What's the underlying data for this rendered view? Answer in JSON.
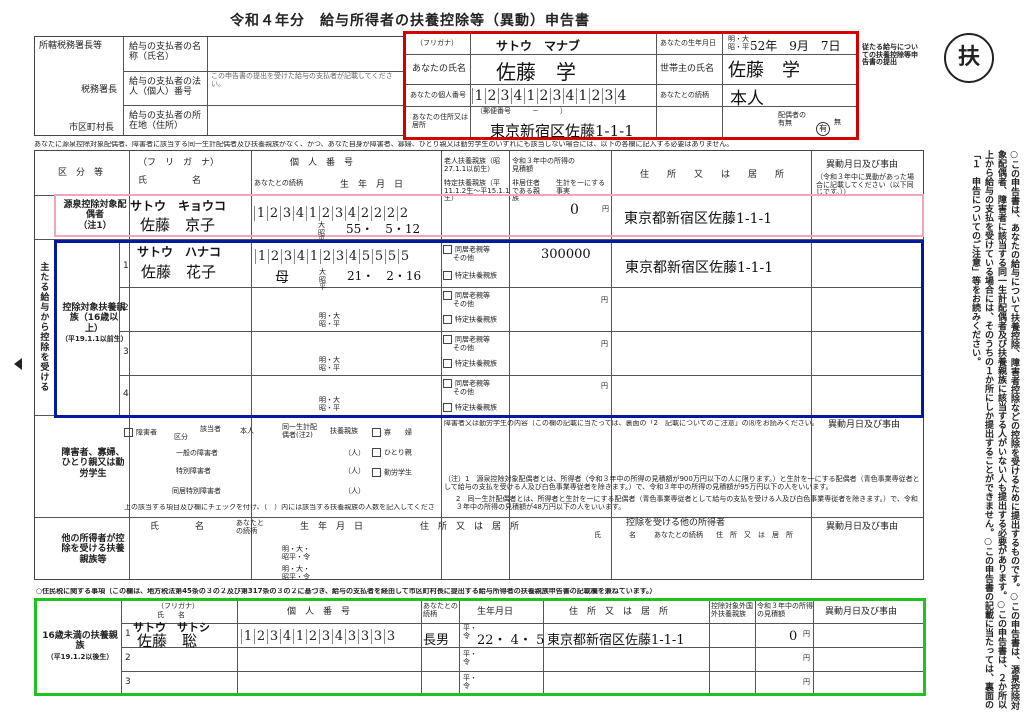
{
  "title": "令和４年分　給与所得者の扶養控除等（異動）申告書",
  "badge": "扶",
  "header": {
    "left_labels": {
      "tax_office": "所轄税務署長等",
      "tax_office_suffix": "税務署長",
      "city": "市区町村長"
    },
    "payer_name": "給与の支払者の名称（氏名）",
    "payer_number": "給与の支払者の法人（個人）番号",
    "payer_number_note": "この申告書の提出を受けた給与の支払者が記載してください。",
    "payer_address": "給与の支払者の所在地（住所）",
    "furigana_label": "（フリガナ）",
    "furigana": "サトウ　マナブ",
    "name_label": "あなたの氏名",
    "name": "佐藤　学",
    "mynumber_label": "あなたの個人番号",
    "mynumber": [
      "1",
      "2",
      "3",
      "4",
      "1",
      "2",
      "3",
      "4",
      "1",
      "2",
      "3",
      "4"
    ],
    "address_label": "あなたの住所又は居所",
    "postal": "（郵便番号　　　－　　　）",
    "address": "東京新宿区佐藤1-1-1",
    "birth_label": "あなたの生年月日",
    "era": "明・大昭・平",
    "birth": "52年　9月　7日",
    "householder_label": "世帯主の氏名",
    "householder": "佐藤　学",
    "relation_label": "あなたとの続柄",
    "relation": "本人",
    "spouse_label": "配偶者の有無",
    "spouse_yes": "有",
    "spouse_no": "無",
    "right_note": "従たる給与についての扶養控除等申告書の提出"
  },
  "notice": "あなたに源泉控除対象配偶者、障害者に該当する同一生計配偶者及び扶養親族がなく、かつ、あなた自身が障害者、寡婦、ひとり親又は勤労学生のいずれにも該当しない場合には、以下の各欄に記入する必要はありません。",
  "columns": {
    "category": "区　分　等",
    "furigana": "（フ　リ　ガ　ナ）",
    "name": "氏　　　　　名",
    "mynumber": "個　人　番　号",
    "relation": "あなたとの続柄",
    "birth": "生　年　月　日",
    "elderly": "老人扶養親族（昭27.1.1以前生）",
    "specific": "特定扶養親族（平11.1.2生～平15.1.1生）",
    "income": "令和３年中の所得の見積額",
    "nonresident": "非居住者である親族",
    "same_budget": "生計を一にする事実",
    "address": "住　　所　　又　　は　　居　　所",
    "change": "異動月日及び事由",
    "change_note": "（令和３年中に異動があった場合に記載してください（以下同じです。））"
  },
  "sectionA": {
    "label": "源泉控除対象配偶者",
    "note": "（注1）",
    "furigana": "サトウ　キョウコ",
    "name": "佐藤　京子",
    "mynumber": [
      "1",
      "2",
      "3",
      "4",
      "1",
      "2",
      "3",
      "4",
      "2",
      "2",
      "2",
      "2"
    ],
    "era": "大昭平",
    "birth": "55・　5・12",
    "income": "0",
    "yen": "円",
    "address": "東京都新宿区佐藤1-1-1"
  },
  "sectionB": {
    "side": "主たる給与から控除を受ける",
    "label": "控除対象扶養親族（16歳以上）",
    "sub": "（平19.1.1以前生）",
    "row1": {
      "num": "1",
      "furigana": "サトウ　ハナコ",
      "name": "佐藤　花子",
      "mynumber": [
        "1",
        "2",
        "3",
        "4",
        "1",
        "2",
        "3",
        "4",
        "5",
        "5",
        "5",
        "5"
      ],
      "relation": "母",
      "era": "大昭平",
      "birth": "21・　2・16",
      "opt1": "同居老親等",
      "opt2": "その他",
      "opt3": "特定扶養親族",
      "income": "300000",
      "address": "東京都新宿区佐藤1-1-1"
    },
    "nums": [
      "2",
      "3",
      "4"
    ],
    "era_empty": "明・大昭・平",
    "opt_a": "同居老親等",
    "opt_b": "その他",
    "opt_c": "特定扶養親族",
    "yen": "円"
  },
  "sectionC": {
    "label": "障害者、寡婦、ひとり親又は勤労学生",
    "disabled": "障害者",
    "kubun": "区分",
    "applicable": "該当者",
    "self": "本人",
    "same_spouse": "同一生計配偶者(注2)",
    "dependents": "扶養親族",
    "rows": [
      "一般の障害者",
      "特別障害者",
      "同居特別障害者"
    ],
    "people": "（人）",
    "widow": "寡　　婦",
    "single": "ひとり親",
    "student": "勤労学生",
    "footer": "上の該当する項目及び欄にチェックを付け、（　）内には該当する扶養親族の人数を記入してください。",
    "content_note": "障害者又は勤労学生の内容（この欄の記載に当たっては、裏面の「2　記載についてのご注意」の⑻をお読みください。）",
    "change": "異動月日及び事由",
    "note1": "（注）1　源泉控除対象配偶者とは、所得者（令和３年中の所得の見積額が900万円以下の人に限ります。）と生計を一にする配偶者（青色事業専従者として給与の支払を受ける人及び白色事業専従者を除きます。）で、令和３年中の所得の見積額が95万円以下の人をいいます。",
    "note2": "2　同一生計配偶者とは、所得者と生計を一にする配偶者（青色事業専従者として給与の支払を受ける人及び白色事業専従者を除きます。）で、令和３年中の所得の見積額が48万円以下の人をいいます。"
  },
  "sectionD": {
    "label": "他の所得者が控除を受ける扶養親族等",
    "name": "氏　　　　名",
    "relation": "あなたとの続柄",
    "birth": "生　年　月　日",
    "address": "住　所　又　は　居　所",
    "other": "控除を受ける他の所得者",
    "other_name": "氏　　　　名",
    "other_relation": "あなたとの続柄",
    "other_address": "住　所　又　は　居　所",
    "change": "異動月日及び事由",
    "era": "明・大・昭平・令"
  },
  "resident_note": "○住民税に関する事項（この欄は、地方税法第45条の３の２及び第317条の３の２に基づき、給与の支払者を経由して市区町村長に提出する給与所得者の扶養親族申告書の記載欄を兼ねています。）",
  "sectionU16": {
    "label": "16歳未満の扶養親族",
    "sub": "（平19.1.2以後生）",
    "furigana_label": "（フリガナ）",
    "name_label": "氏　　名",
    "mynumber_label": "個　人　番　号",
    "relation_label": "あなたとの続柄",
    "birth_label": "生年月日",
    "address_label": "住　所　又　は　居　所",
    "nonresident_label": "控除対象外国外扶養親族",
    "income_label": "令和３年中の所得の見積額",
    "change_label": "異動月日及び事由",
    "row1": {
      "num": "1",
      "furigana": "サトウ　サトシ",
      "name": "佐藤　聡",
      "mynumber": [
        "1",
        "2",
        "3",
        "4",
        "1",
        "2",
        "3",
        "4",
        "3",
        "3",
        "3",
        "3"
      ],
      "relation": "長男",
      "era": "平・令",
      "birth": "22・ 4・ 5",
      "address": "東京都新宿区佐藤1-1-1",
      "income": "0",
      "yen": "円"
    },
    "nums": [
      "2",
      "3"
    ],
    "era_empty": "平・令",
    "yen": "円"
  },
  "right_text": "○この申告書は、あなたの給与について扶養控除、障害者控除などの控除を受けるために提出するものです。○この申告書は、源泉控除対象配偶者、障害者に該当する同一生計配偶者及び扶養親族に該当する人がいない人も提出する必要があります。○この申告書は、２か所以上から給与の支払を受けている場合には、そのうちの１か所にしか提出することができません。○この申告書の記載に当たっては、裏面の「１　申告についてのご注意」等をお読みください。",
  "colors": {
    "red": "#d40000",
    "pink": "#f2a6b8",
    "blue": "#001a9e",
    "green": "#1fc21f"
  }
}
